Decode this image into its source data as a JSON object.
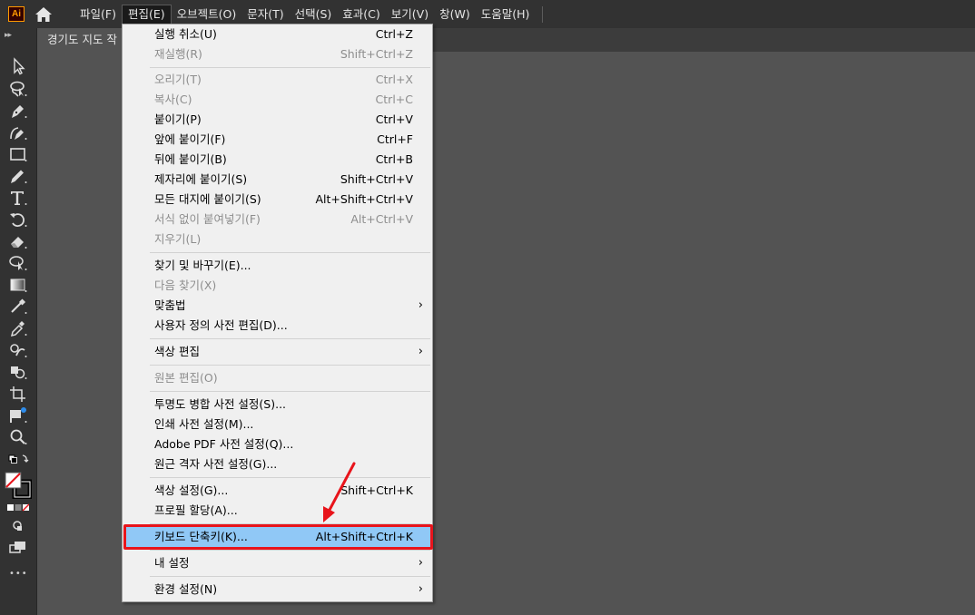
{
  "app": {
    "logo": "Ai"
  },
  "menubar": {
    "items": [
      "파일(F)",
      "편집(E)",
      "오브젝트(O)",
      "문자(T)",
      "선택(S)",
      "효과(C)",
      "보기(V)",
      "창(W)",
      "도움말(H)"
    ]
  },
  "document": {
    "tab_title": "경기도 지도 작"
  },
  "edit_menu": {
    "items": [
      {
        "label": "실행 취소(U)",
        "shortcut": "Ctrl+Z"
      },
      {
        "label": "재실행(R)",
        "shortcut": "Shift+Ctrl+Z"
      },
      {
        "label": "오리기(T)",
        "shortcut": "Ctrl+X"
      },
      {
        "label": "복사(C)",
        "shortcut": "Ctrl+C"
      },
      {
        "label": "붙이기(P)",
        "shortcut": "Ctrl+V"
      },
      {
        "label": "앞에 붙이기(F)",
        "shortcut": "Ctrl+F"
      },
      {
        "label": "뒤에 붙이기(B)",
        "shortcut": "Ctrl+B"
      },
      {
        "label": "제자리에 붙이기(S)",
        "shortcut": "Shift+Ctrl+V"
      },
      {
        "label": "모든 대지에 붙이기(S)",
        "shortcut": "Alt+Shift+Ctrl+V"
      },
      {
        "label": "서식 없이 붙여넣기(F)",
        "shortcut": "Alt+Ctrl+V"
      },
      {
        "label": "지우기(L)",
        "shortcut": ""
      },
      {
        "label": "찾기 및 바꾸기(E)...",
        "shortcut": ""
      },
      {
        "label": "다음 찾기(X)",
        "shortcut": ""
      },
      {
        "label": "맞춤법",
        "shortcut": ""
      },
      {
        "label": "사용자 정의 사전 편집(D)...",
        "shortcut": ""
      },
      {
        "label": "색상 편집",
        "shortcut": ""
      },
      {
        "label": "원본 편집(O)",
        "shortcut": ""
      },
      {
        "label": "투명도 병합 사전 설정(S)...",
        "shortcut": ""
      },
      {
        "label": "인쇄 사전 설정(M)...",
        "shortcut": ""
      },
      {
        "label": "Adobe PDF 사전 설정(Q)...",
        "shortcut": ""
      },
      {
        "label": "원근 격자 사전 설정(G)...",
        "shortcut": ""
      },
      {
        "label": "색상 설정(G)...",
        "shortcut": "Shift+Ctrl+K"
      },
      {
        "label": "프로필 할당(A)...",
        "shortcut": ""
      },
      {
        "label": "키보드 단축키(K)...",
        "shortcut": "Alt+Shift+Ctrl+K"
      },
      {
        "label": "내 설정",
        "shortcut": ""
      },
      {
        "label": "환경 설정(N)",
        "shortcut": ""
      }
    ],
    "submenu_glyph": "›"
  },
  "colors": {
    "menubar_bg": "#323232",
    "canvas_bg": "#535353",
    "menu_bg": "#f0f0f0",
    "menu_highlight": "#90c8f6",
    "annotation_red": "#e8141b"
  },
  "toolbar": {
    "icons": [
      "selection-tool-icon",
      "lasso-tool-icon",
      "pen-tool-icon",
      "curvature-tool-icon",
      "rectangle-tool-icon",
      "pencil-tool-icon",
      "type-tool-icon",
      "rotate-tool-icon",
      "eraser-tool-icon",
      "free-transform-icon",
      "gradient-tool-icon",
      "mesh-tool-icon",
      "eyedropper-tool-icon",
      "blend-tool-icon",
      "shape-builder-icon",
      "artboard-tool-icon",
      "graph-tool-icon",
      "zoom-tool-icon"
    ],
    "more_glyph": "•••"
  }
}
